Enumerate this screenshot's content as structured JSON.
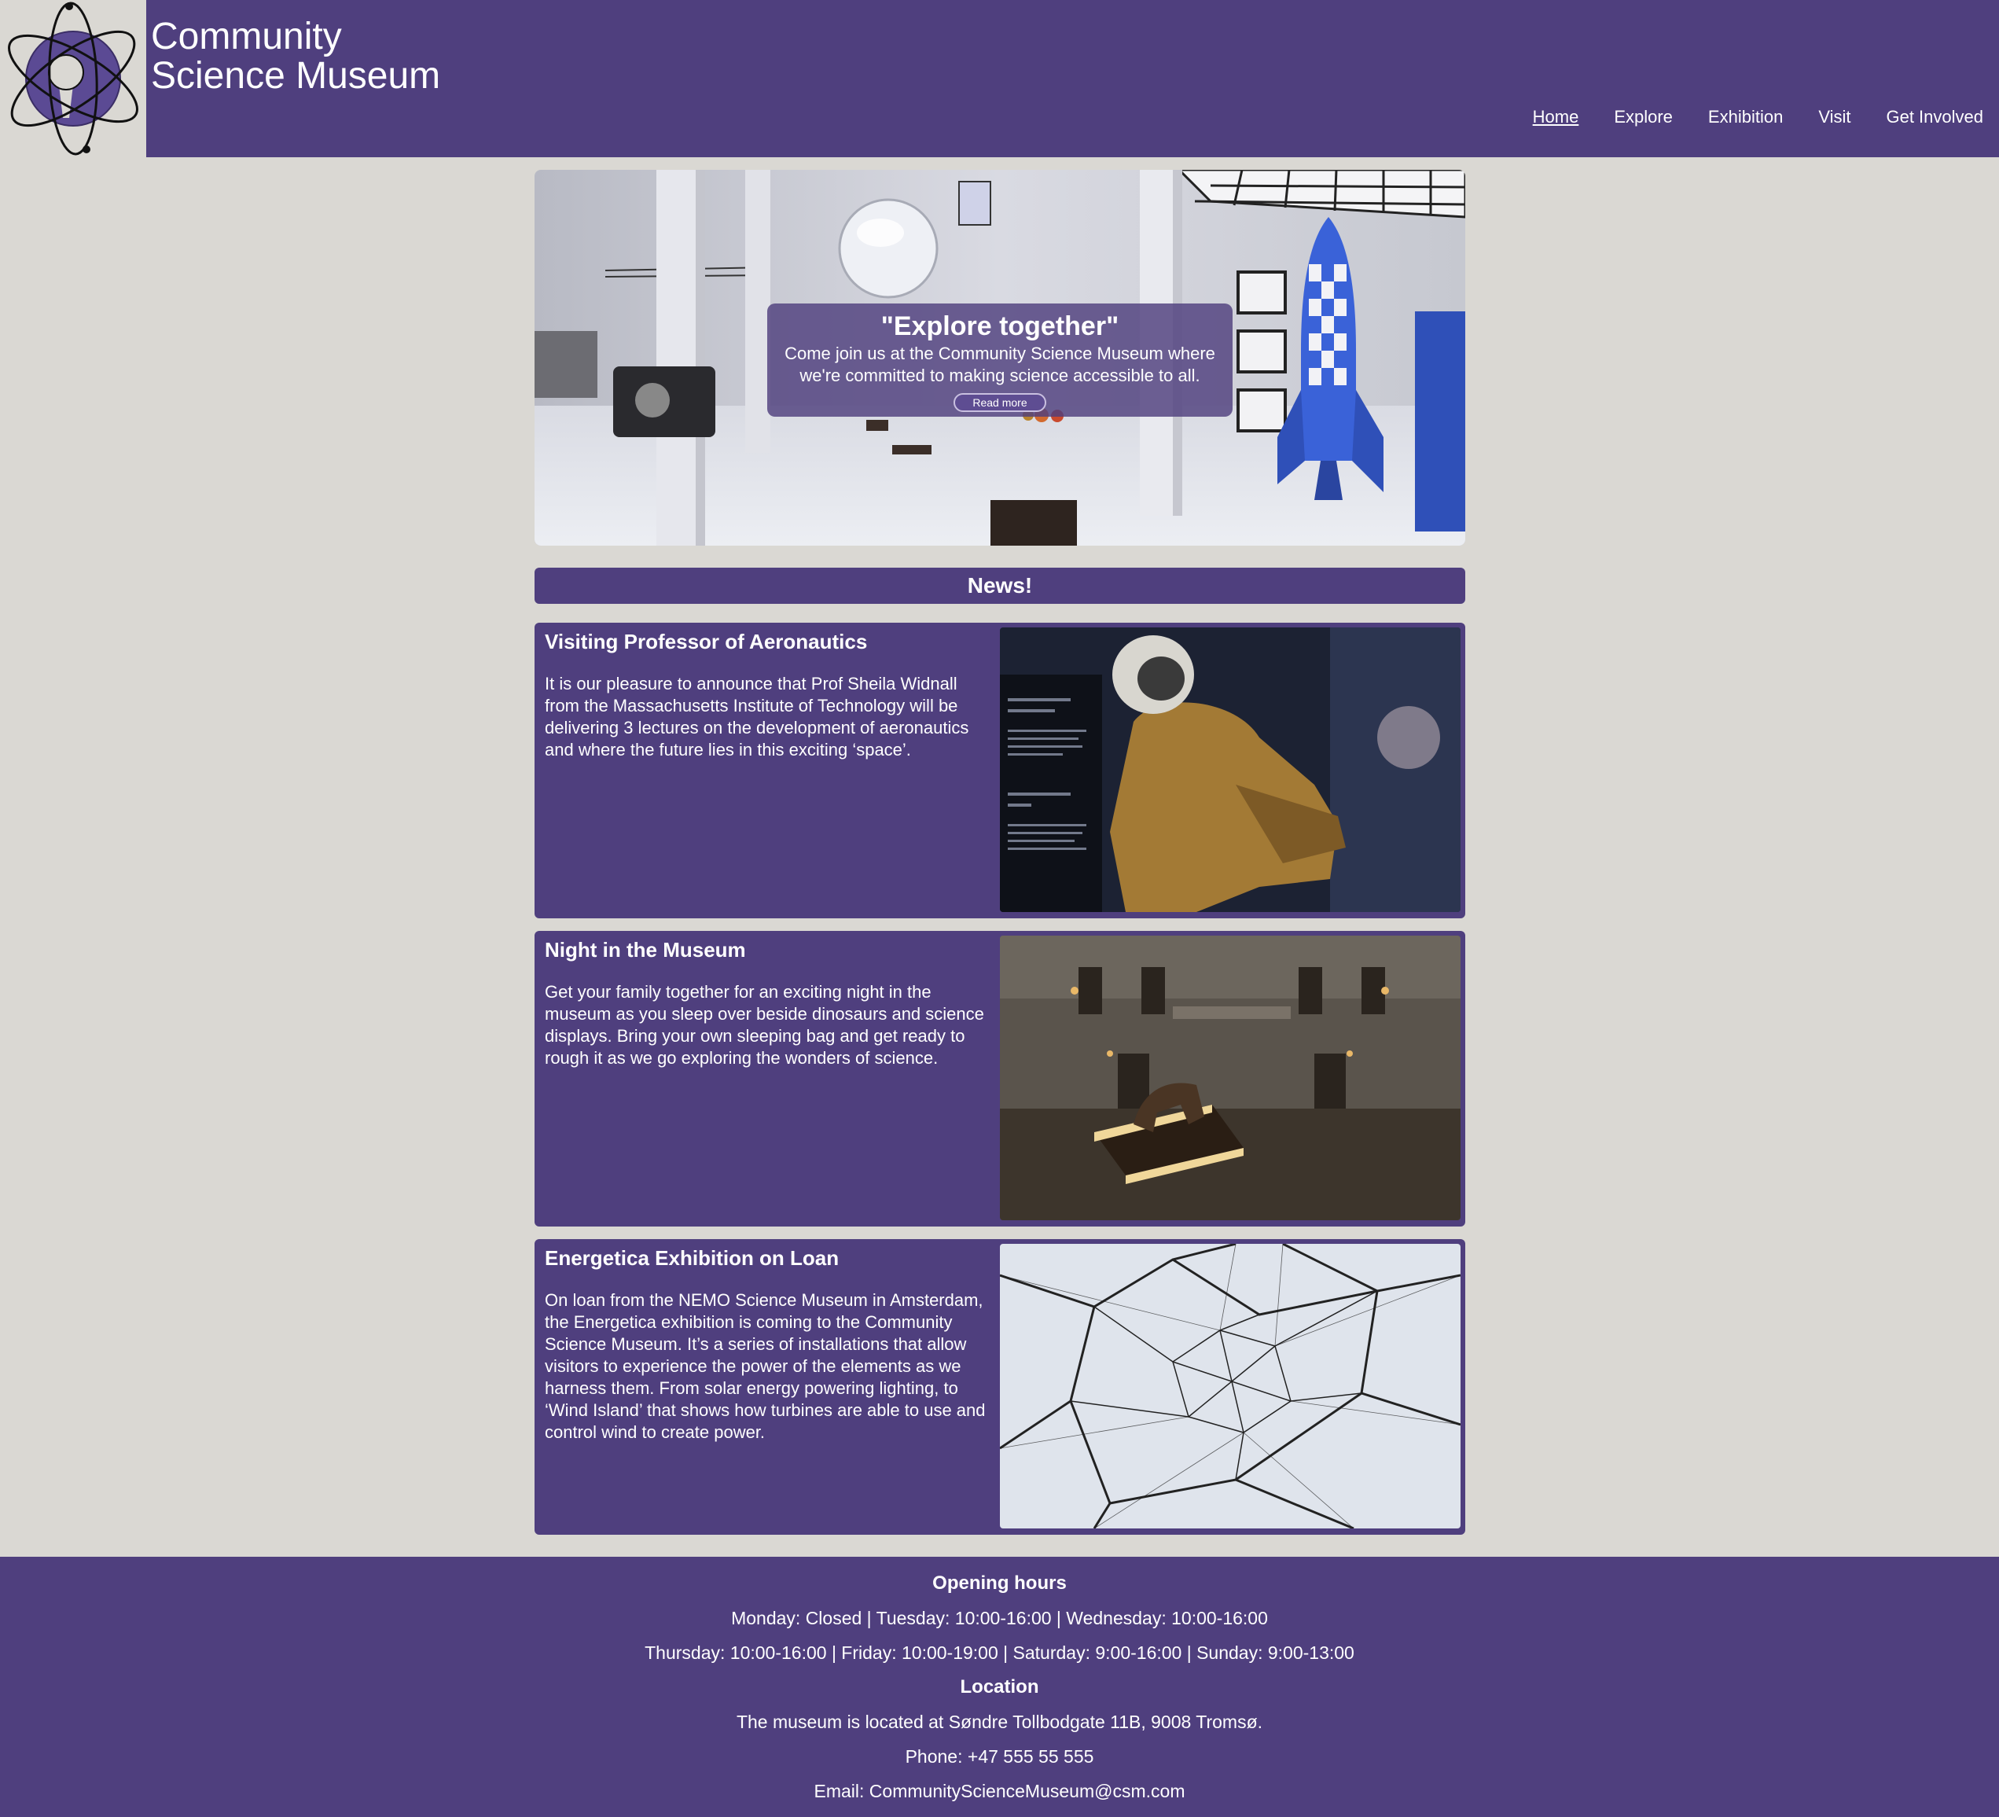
{
  "header": {
    "title_line1": "Community",
    "title_line2": "Science Museum",
    "logo_icon": "atom-keyhole-logo-icon"
  },
  "nav": {
    "items": [
      {
        "label": "Home",
        "active": true
      },
      {
        "label": "Explore"
      },
      {
        "label": "Exhibition"
      },
      {
        "label": "Visit"
      },
      {
        "label": "Get Involved"
      }
    ]
  },
  "hero": {
    "heading": "\"Explore together\"",
    "text_line1": "Come join us at the Community Science Museum where",
    "text_line2": "we're committed to making science accessible to all.",
    "button_label": "Read more"
  },
  "news": {
    "heading": "News!",
    "articles": [
      {
        "title": "Visiting Professor of Aeronautics",
        "body": "It is our pleasure to announce that Prof Sheila Widnall from the Massachusetts Institute of Technology will be delivering 3 lectures on the development of aeronautics and where the future lies in this exciting ‘space’."
      },
      {
        "title": "Night in the Museum",
        "body": "Get your family together for an exciting night in the museum as you sleep over beside dinosaurs and science displays. Bring your own sleeping bag and get ready to rough it as we go exploring the wonders of science."
      },
      {
        "title": "Energetica Exhibition on Loan",
        "body": "On loan from the NEMO Science Museum in Amsterdam, the Energetica exhibition is coming to the Community Science Museum. It’s a series of installations that allow visitors to experience the power of the elements as we harness them. From solar energy powering lighting, to ‘Wind Island’ that shows how turbines are able to use and control wind to create power."
      }
    ]
  },
  "footer": {
    "hours_heading": "Opening hours",
    "hours_line1": "Monday: Closed | Tuesday: 10:00-16:00 | Wednesday: 10:00-16:00",
    "hours_line2": "Thursday: 10:00-16:00 | Friday: 10:00-19:00 | Saturday: 9:00-16:00 | Sunday: 9:00-13:00",
    "location_heading": "Location",
    "address": "The museum is located at Søndre Tollbodgate 11B, 9008 Tromsø.",
    "phone": "Phone: +47 555 55 555",
    "email": "Email: CommunityScienceMuseum@csm.com"
  },
  "colors": {
    "brand_purple": "#4f3f7e",
    "page_background": "#dad8d3"
  }
}
